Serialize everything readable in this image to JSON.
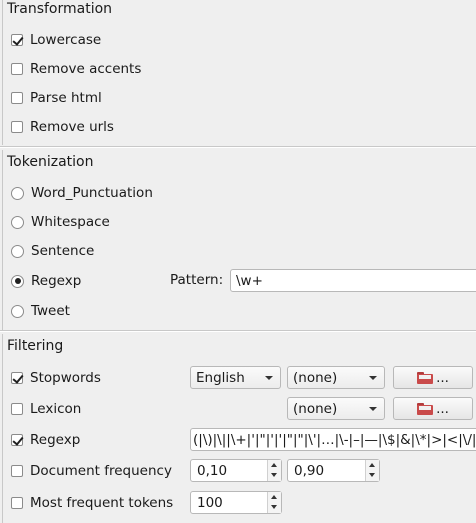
{
  "transformation": {
    "title": "Transformation",
    "items": [
      {
        "label": "Lowercase",
        "checked": true
      },
      {
        "label": "Remove accents",
        "checked": false
      },
      {
        "label": "Parse html",
        "checked": false
      },
      {
        "label": "Remove urls",
        "checked": false
      }
    ]
  },
  "tokenization": {
    "title": "Tokenization",
    "options": [
      {
        "label": "Word_Punctuation",
        "selected": false
      },
      {
        "label": "Whitespace",
        "selected": false
      },
      {
        "label": "Sentence",
        "selected": false
      },
      {
        "label": "Regexp",
        "selected": true
      },
      {
        "label": "Tweet",
        "selected": false
      }
    ],
    "pattern_label": "Pattern:",
    "pattern_value": "\\w+"
  },
  "filtering": {
    "title": "Filtering",
    "stopwords": {
      "label": "Stopwords",
      "checked": true,
      "language": "English",
      "file": "(none)",
      "browse_label": "..."
    },
    "lexicon": {
      "label": "Lexicon",
      "checked": false,
      "file": "(none)",
      "browse_label": "..."
    },
    "regexp": {
      "label": "Regexp",
      "checked": true,
      "value": "(|\\)|\\||\\+|'|\"|'|'|\"|\"|\\'|…|\\-|–|—|\\$|&|\\*|>|<|\\/|"
    },
    "doc_freq": {
      "label": "Document frequency",
      "checked": false,
      "min": "0,10",
      "max": "0,90"
    },
    "most_frequent": {
      "label": "Most frequent tokens",
      "checked": false,
      "value": "100"
    }
  },
  "icons": {
    "browse": "folder-icon"
  }
}
